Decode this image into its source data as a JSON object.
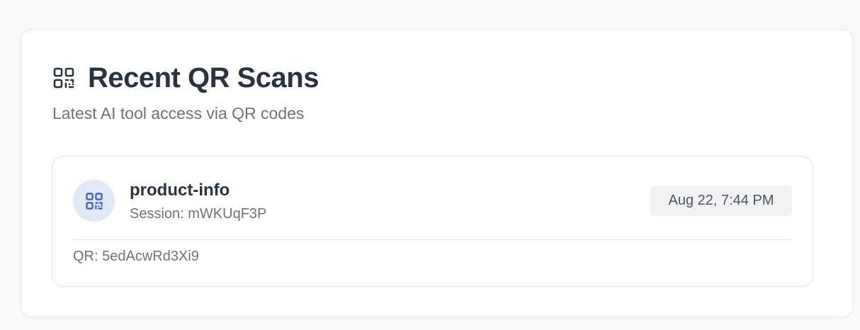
{
  "card": {
    "icon": "qr-code-icon",
    "title": "Recent QR Scans",
    "subtitle": "Latest AI tool access via QR codes"
  },
  "scans": [
    {
      "icon": "qr-code-icon",
      "tool": "product-info",
      "session": "Session: mWKUqF3P",
      "timestamp": "Aug 22, 7:44 PM",
      "qr": "QR: 5edAcwRd3Xi9"
    }
  ],
  "colors": {
    "title": "#2a3342",
    "muted": "#6b7280",
    "accent_icon": "#3b63c4",
    "avatar_bg": "#e1e9f8",
    "badge_bg": "#f1f2f4"
  }
}
